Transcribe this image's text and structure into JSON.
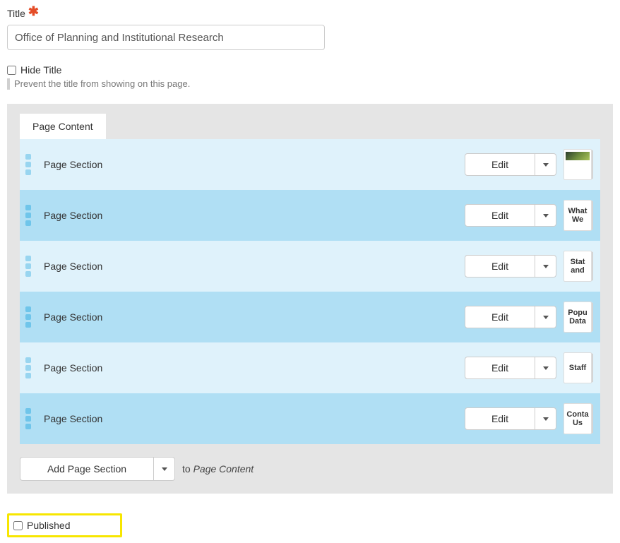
{
  "title": {
    "label": "Title",
    "required_mark": "✱",
    "value": "Office of Planning and Institutional Research"
  },
  "hide_title": {
    "label": "Hide Title",
    "help": "Prevent the title from showing on this page."
  },
  "content": {
    "tab_label": "Page Content",
    "edit_label": "Edit",
    "sections": [
      {
        "label": "Page Section",
        "preview": ""
      },
      {
        "label": "Page Section",
        "preview": "What We"
      },
      {
        "label": "Page Section",
        "preview": "Stat and"
      },
      {
        "label": "Page Section",
        "preview": "Popu Data"
      },
      {
        "label": "Page Section",
        "preview": "Staff"
      },
      {
        "label": "Page Section",
        "preview": "Conta Us"
      }
    ],
    "add_button": "Add Page Section",
    "add_suffix_to": "to",
    "add_suffix_target": "Page Content"
  },
  "published": {
    "label": "Published"
  }
}
